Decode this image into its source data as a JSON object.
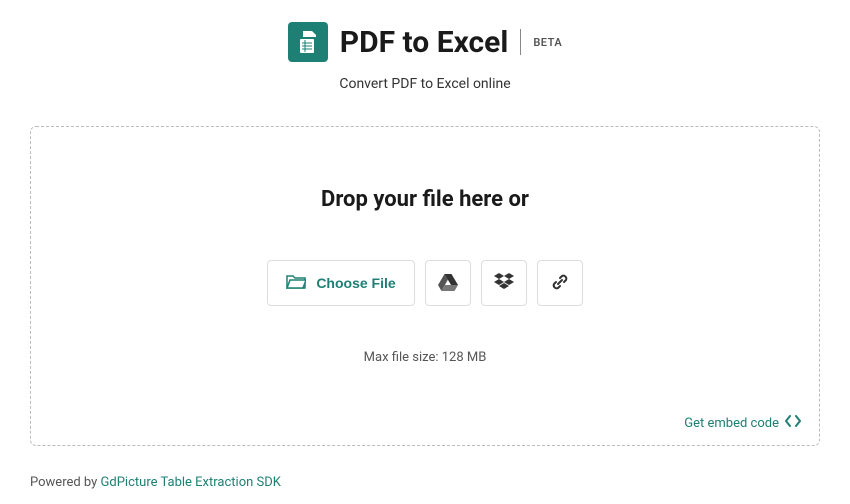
{
  "header": {
    "title": "PDF to Excel",
    "beta_label": "BETA",
    "subtitle": "Convert PDF to Excel online"
  },
  "dropzone": {
    "drop_title": "Drop your file here or",
    "choose_file_label": "Choose File",
    "max_size_prefix": "Max file size: ",
    "max_size_value": "128 MB",
    "embed_link_label": "Get embed code"
  },
  "footer": {
    "powered_prefix": "Powered by ",
    "powered_link": "GdPicture Table Extraction SDK"
  },
  "icons": {
    "logo": "pdf-excel-logo-icon",
    "folder": "folder-icon",
    "google_drive": "google-drive-icon",
    "dropbox": "dropbox-icon",
    "link": "link-icon",
    "code": "code-icon"
  },
  "colors": {
    "primary": "#1e8074",
    "text": "#1a1a1a",
    "muted": "#555555",
    "border": "#dddddd"
  }
}
